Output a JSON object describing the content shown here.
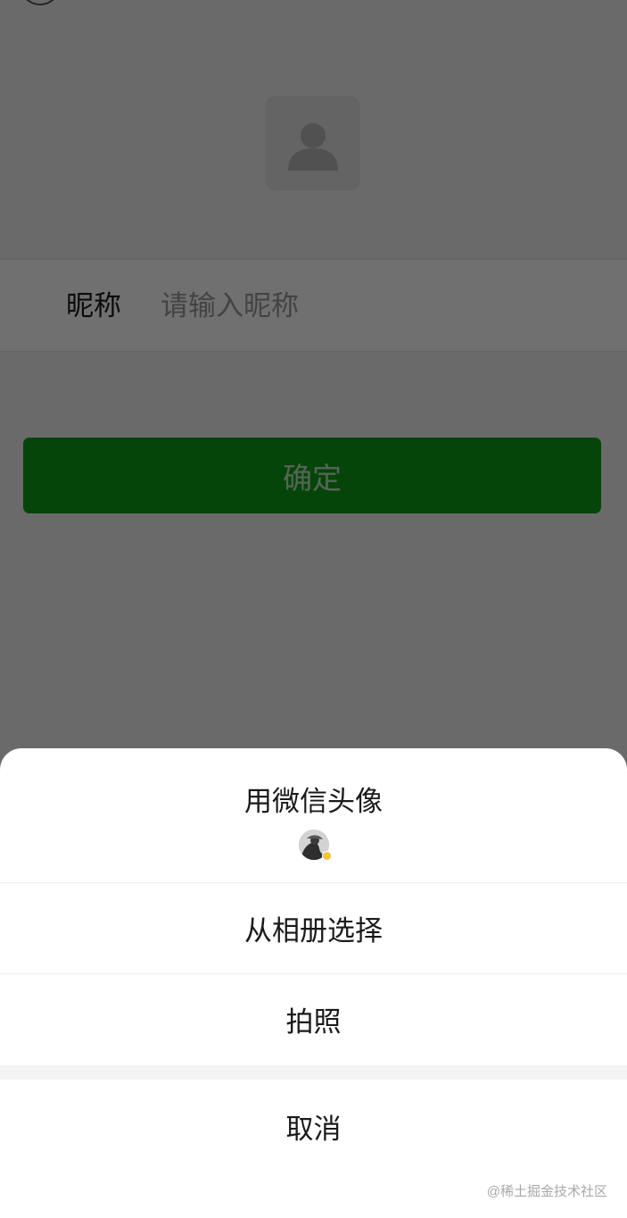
{
  "form": {
    "nickname_label": "昵称",
    "nickname_placeholder": "请输入昵称",
    "nickname_value": "",
    "confirm_label": "确定"
  },
  "action_sheet": {
    "use_wechat_avatar_label": "用微信头像",
    "choose_from_album_label": "从相册选择",
    "take_photo_label": "拍照",
    "cancel_label": "取消"
  },
  "watermark": "@稀土掘金技术社区",
  "colors": {
    "primary_green": "#0f9d16",
    "mask": "rgba(0,0,0,0.56)",
    "sheet_background": "#ffffff",
    "avatar_badge": "#f3c33b"
  },
  "icons": {
    "avatar_placeholder": "person-silhouette-icon",
    "wechat_avatar": "user-avatar-thumbnail"
  }
}
